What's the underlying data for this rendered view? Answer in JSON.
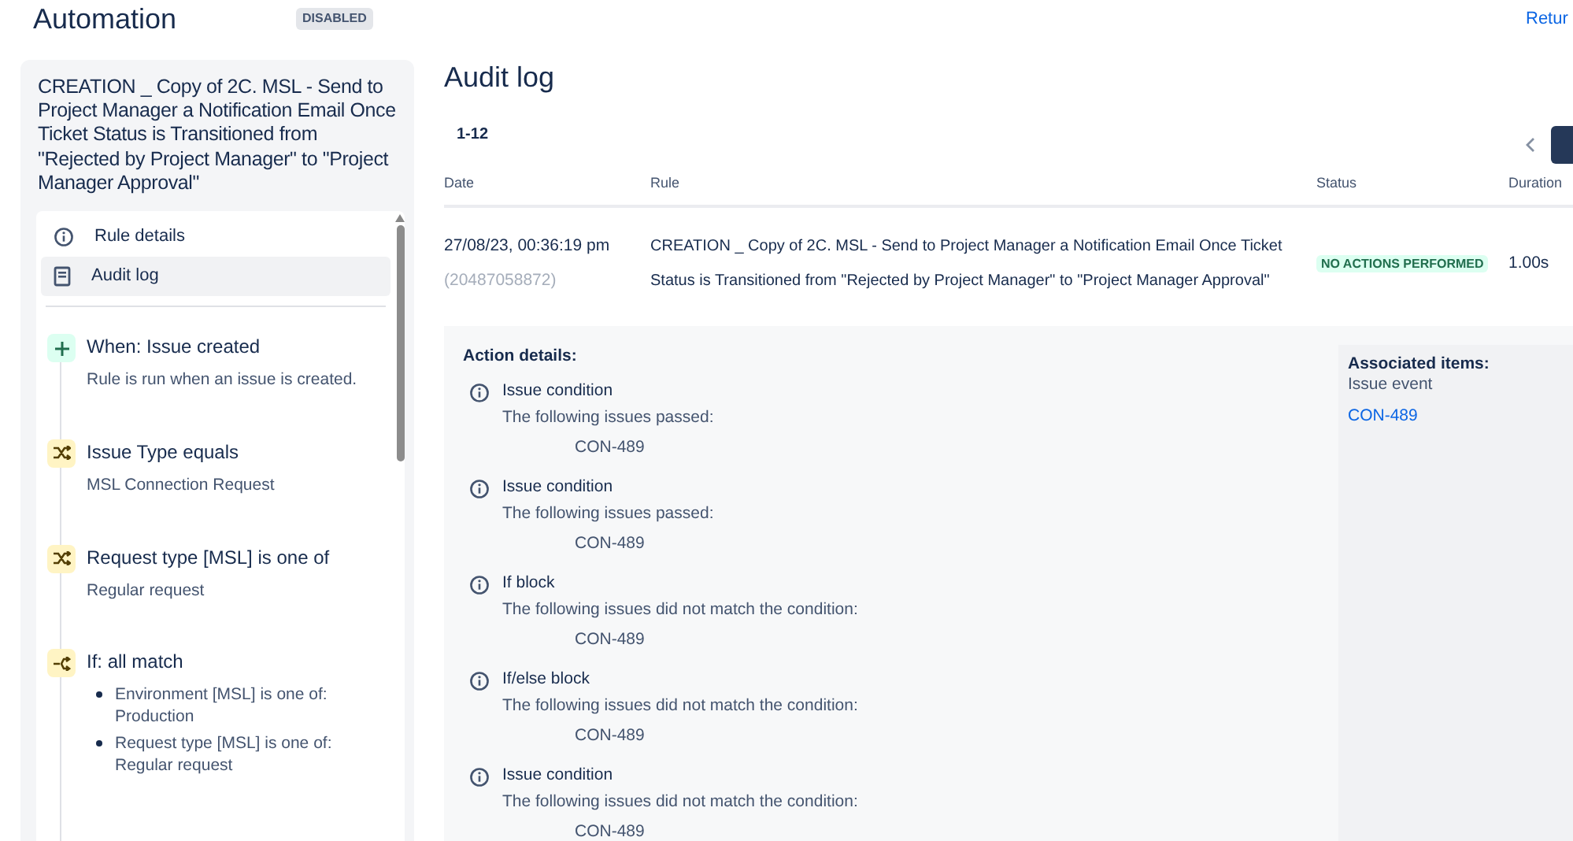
{
  "header": {
    "title": "Automation",
    "badge": "DISABLED",
    "link": "Retur"
  },
  "rule": {
    "title": "CREATION _ Copy of 2C. MSL - Send to Project Manager a Notification Email Once Ticket Status is Transitioned from \"Rejected by Project Manager\" to \"Project Manager Approval\""
  },
  "nav": [
    {
      "label": "Rule details",
      "kind": "info",
      "selected": false
    },
    {
      "label": "Audit log",
      "kind": "log",
      "selected": true
    }
  ],
  "steps": [
    {
      "kind": "trigger",
      "title": "When: Issue created",
      "lines": [
        "Rule is run when an issue is created."
      ]
    },
    {
      "kind": "condition",
      "title": "Issue Type equals",
      "lines": [
        "MSL Connection Request"
      ]
    },
    {
      "kind": "condition",
      "title": "Request type [MSL] is one of",
      "lines": [
        "Regular request"
      ]
    },
    {
      "kind": "branch",
      "title": "If: all match",
      "bullets": [
        "Environment [MSL] is one of: Production",
        "Request type [MSL] is one of: Regular request"
      ]
    }
  ],
  "audit": {
    "title": "Audit log",
    "range": "1-12",
    "columns": [
      "Date",
      "Rule",
      "Status",
      "Duration"
    ],
    "row": {
      "date": "27/08/23, 00:36:19 pm",
      "id": "(20487058872)",
      "rule": "CREATION _ Copy of 2C. MSL - Send to Project Manager a Notification Email Once Ticket Status is Transitioned from \"Rejected by Project Manager\" to \"Project Manager Approval\"",
      "status": "NO ACTIONS PERFORMED",
      "duration": "1.00s"
    },
    "details_title": "Action details:",
    "actions": [
      {
        "name": "Issue condition",
        "message": "The following issues passed:",
        "issue": "CON-489"
      },
      {
        "name": "Issue condition",
        "message": "The following issues passed:",
        "issue": "CON-489"
      },
      {
        "name": "If block",
        "message": "The following issues did not match the condition:",
        "issue": "CON-489"
      },
      {
        "name": "If/else block",
        "message": "The following issues did not match the condition:",
        "issue": "CON-489"
      },
      {
        "name": "Issue condition",
        "message": "The following issues did not match the condition:",
        "issue": "CON-489"
      }
    ],
    "associated": {
      "title": "Associated items:",
      "subtitle": "Issue event",
      "link": "CON-489"
    }
  }
}
